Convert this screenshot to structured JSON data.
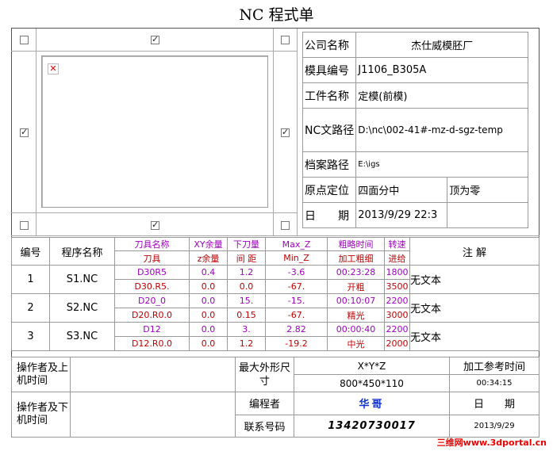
{
  "title": "NC 程式单",
  "info": {
    "company_label": "公司名称",
    "company": "杰仕威模胚厂",
    "mold_label": "模具编号",
    "mold": "J1106_B305A",
    "part_label": "工件名称",
    "part": "定模(前模)",
    "path_label": "NC文路径",
    "path": "D:\\nc\\002-41#-mz-d-sgz-temp",
    "archive_label": "档案路径",
    "archive": "E:\\igs",
    "origin_label": "原点定位",
    "origin_xy": "四面分中",
    "origin_z": "顶为零",
    "date_label": "日　　期",
    "date": "2013/9/29 22:3"
  },
  "headers": {
    "no": "编号",
    "prog": "程序名称",
    "tool_name": "刀具名称",
    "tool": "刀具",
    "xy": "XY余量",
    "z": "z余量",
    "down": "下刀量",
    "step": "间 距",
    "maxz": "Max_Z",
    "minz": "Min_Z",
    "time": "粗略时间",
    "mode": "加工粗细",
    "speed": "转速",
    "feed": "进给",
    "note": "注 解"
  },
  "rows": [
    {
      "no": "1",
      "prog": "S1.NC",
      "tool_name": "D30R5",
      "tool": "D30.R5.",
      "xy": "0.4",
      "z": "0.0",
      "down": "1.2",
      "step": "0.0",
      "maxz": "-3.6",
      "minz": "-67.",
      "time": "00:23:28",
      "mode": "开粗",
      "speed": "1800",
      "feed": "3500",
      "note": "无文本"
    },
    {
      "no": "2",
      "prog": "S2.NC",
      "tool_name": "D20_0",
      "tool": "D20.R0.0",
      "xy": "0.0",
      "z": "0.0",
      "down": "15.",
      "step": "0.15",
      "maxz": "-15.",
      "minz": "-67.",
      "time": "00:10:07",
      "mode": "精光",
      "speed": "2200",
      "feed": "3000",
      "note": "无文本"
    },
    {
      "no": "3",
      "prog": "S3.NC",
      "tool_name": "D12",
      "tool": "D12.R0.0",
      "xy": "0.0",
      "z": "0.0",
      "down": "3.",
      "step": "1.2",
      "maxz": "2.82",
      "minz": "-19.2",
      "time": "00:00:40",
      "mode": "中光",
      "speed": "2200",
      "feed": "2000",
      "note": "无文本"
    }
  ],
  "footer": {
    "op_on": "操作者及上机时间",
    "op_off": "操作者及下机时间",
    "max_size_label": "最大外形尺寸",
    "xyz_label": "X*Y*Z",
    "xyz": "800*450*110",
    "ref_time_label": "加工参考时间",
    "ref_time": "00:34:15",
    "programmer_label": "编程者",
    "programmer": "华哥",
    "date_label": "日　　期",
    "phone_label": "联系号码",
    "phone": "13420730017",
    "date": "2013/9/29"
  },
  "watermark": "三维网www.3dportal.cn"
}
